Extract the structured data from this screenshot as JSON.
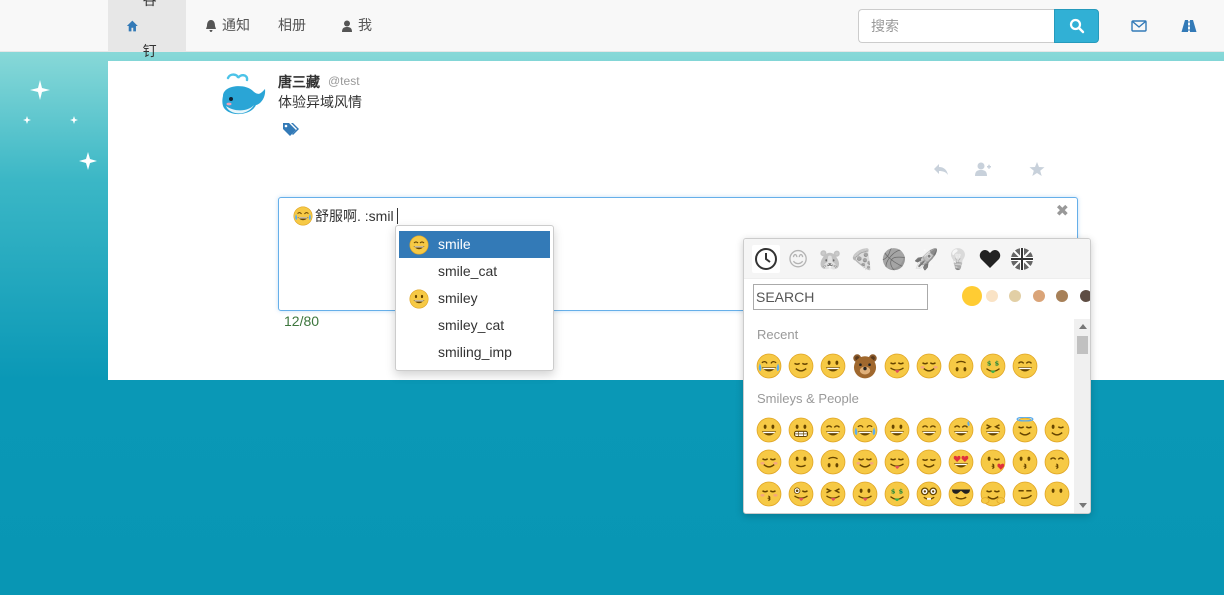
{
  "nav": {
    "items": [
      {
        "label": "谷钉",
        "icon": "home-icon",
        "active": true
      },
      {
        "label": "通知",
        "icon": "bell-icon",
        "active": false
      },
      {
        "label": "相册",
        "icon": "",
        "active": false
      },
      {
        "label": "我",
        "icon": "user-icon",
        "active": false
      }
    ],
    "search_placeholder": "搜索",
    "right_icons": [
      "envelope-icon",
      "road-icon"
    ]
  },
  "post": {
    "author": "唐三藏",
    "handle": "@test",
    "text": "体验异域风情",
    "actions": [
      "reply-icon",
      "follow-icon",
      "star-icon"
    ]
  },
  "compose": {
    "text": "舒服啊. :smil",
    "leading_emoji": "joy",
    "counter": "12/80"
  },
  "autocomplete": {
    "items": [
      {
        "label": "smile",
        "emoji": "smile",
        "selected": true
      },
      {
        "label": "smile_cat",
        "emoji": "",
        "selected": false
      },
      {
        "label": "smiley",
        "emoji": "smiley",
        "selected": false
      },
      {
        "label": "smiley_cat",
        "emoji": "",
        "selected": false
      },
      {
        "label": "smiling_imp",
        "emoji": "",
        "selected": false
      }
    ]
  },
  "picker": {
    "categories": [
      "recent-icon",
      "smileys-icon",
      "animals-icon",
      "food-icon",
      "activity-icon",
      "travel-icon",
      "objects-icon",
      "symbols-icon",
      "flags-icon"
    ],
    "search_placeholder": "SEARCH",
    "tones": [
      "#ffcc33",
      "#fae3c5",
      "#e2cfa5",
      "#daa478",
      "#a78058",
      "#5e4d43"
    ],
    "sections": [
      {
        "label": "Recent",
        "emojis": [
          "joy",
          "relieved",
          "smiley",
          "bear",
          "yum",
          "blush",
          "upside_down",
          "money_mouth",
          "smile"
        ]
      },
      {
        "label": "Smileys & People",
        "emojis": [
          "grinning",
          "grimacing",
          "grin",
          "joy",
          "smiley",
          "smile",
          "sweat_smile",
          "laughing",
          "innocent",
          "wink",
          "blush",
          "slight_smile",
          "upside_down",
          "relaxed",
          "yum",
          "relieved",
          "heart_eyes",
          "kissing_heart",
          "kissing",
          "kissing_smiling_eyes",
          "kissing_closed_eyes",
          "stuck_out_tongue_winking_eye",
          "stuck_out_tongue_closed_eyes",
          "stuck_out_tongue",
          "money_mouth",
          "nerd",
          "sunglasses",
          "hugging",
          "smirk",
          "no_mouth"
        ]
      }
    ]
  },
  "colors": {
    "accent": "#31b0d5",
    "emoji_yellow": "#f6c945",
    "selection": "#337ab7"
  }
}
